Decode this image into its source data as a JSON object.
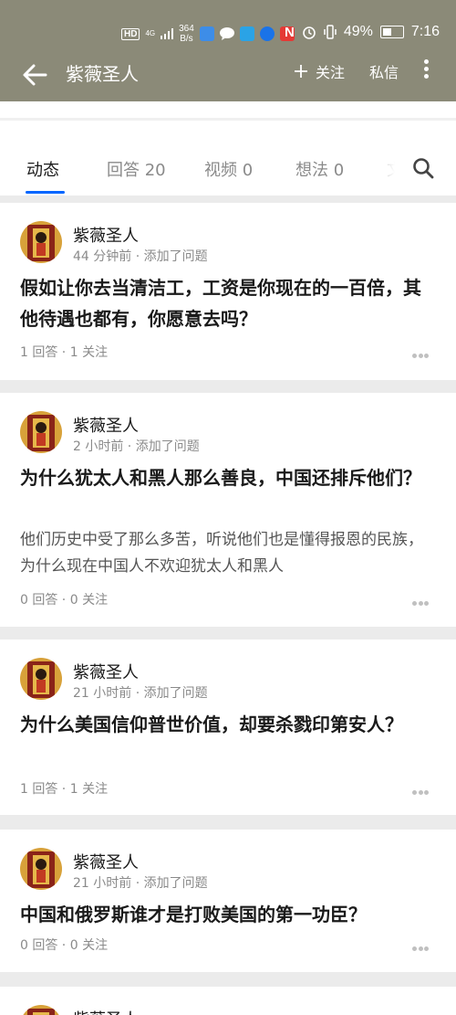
{
  "status_bar": {
    "hd": "HD",
    "signal_type": "4G",
    "speed_value": "364",
    "speed_unit": "B/s",
    "battery": "49%",
    "time": "7:16"
  },
  "header": {
    "title": "紫薇圣人",
    "follow_label": "关注",
    "message_label": "私信"
  },
  "tabs": [
    {
      "label": "动态"
    },
    {
      "label": "回答 20"
    },
    {
      "label": "视频 0"
    },
    {
      "label": "想法 0"
    },
    {
      "label": "文"
    }
  ],
  "feed": [
    {
      "author": "紫薇圣人",
      "meta": "44 分钟前 · 添加了问题",
      "title": "假如让你去当清洁工，工资是你现在的一百倍，其他待遇也都有，你愿意去吗？",
      "excerpt": "",
      "stats": "1 回答 · 1 关注"
    },
    {
      "author": "紫薇圣人",
      "meta": "2 小时前 · 添加了问题",
      "title": "为什么犹太人和黑人那么善良，中国还排斥他们？",
      "excerpt": "他们历史中受了那么多苦，听说他们也是懂得报恩的民族，为什么现在中国人不欢迎犹太人和黑人",
      "stats": "0 回答 · 0 关注"
    },
    {
      "author": "紫薇圣人",
      "meta": "21 小时前 · 添加了问题",
      "title": "为什么美国信仰普世价值，却要杀戮印第安人？",
      "excerpt": "",
      "stats": "1 回答 · 1 关注"
    },
    {
      "author": "紫薇圣人",
      "meta": "21 小时前 · 添加了问题",
      "title": "中国和俄罗斯谁才是打败美国的第一功臣？",
      "excerpt": "",
      "stats": "0 回答 · 0 关注"
    },
    {
      "author": "紫薇圣人"
    }
  ]
}
